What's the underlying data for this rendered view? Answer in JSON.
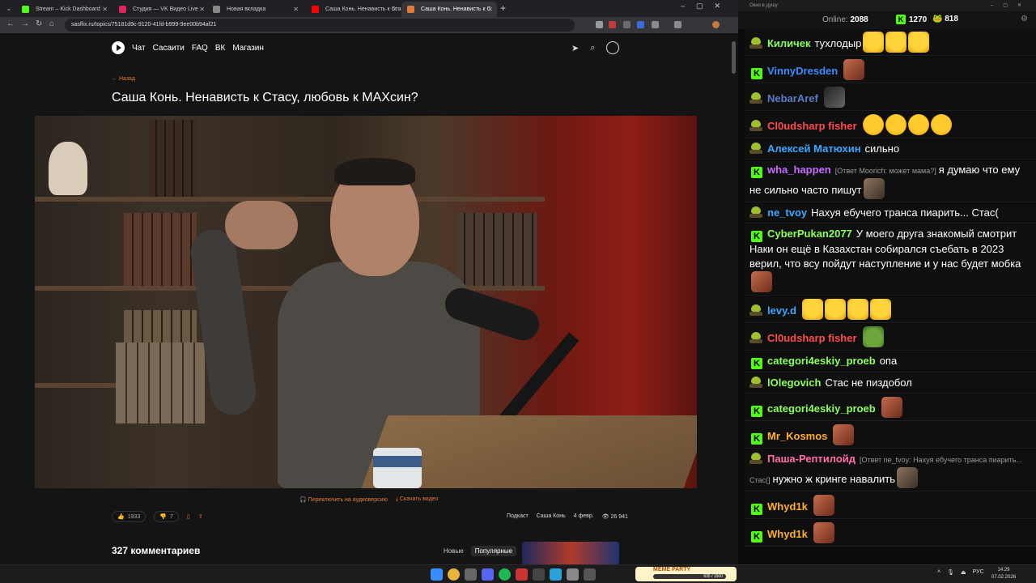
{
  "browser": {
    "tabs": [
      {
        "label": "Stream – Kick Dashboard",
        "color": "#53fc18"
      },
      {
        "label": "Студия — VK Видео Live",
        "color": "#e0245e"
      },
      {
        "label": "Новая вкладка",
        "color": "#888888"
      },
      {
        "label": "Саша Конь. Ненависть к Стасу",
        "color": "#ff0000"
      },
      {
        "label": "Саша Конь. Ненависть к С",
        "color": "#e27b3a"
      }
    ],
    "new_tab": "+",
    "url": "sasflix.ru/topics/75181d9c-9120-41fd-b999-9ee00b94af21"
  },
  "site": {
    "nav": [
      "Чат",
      "Сасаити",
      "FAQ",
      "ВК",
      "Магазин"
    ],
    "back": "← Назад",
    "title": "Саша Конь. Ненависть к Стасу, любовь к МАХсин?",
    "audio_link": "Переключить на аудиоверсию",
    "download_link": "Скачать видео",
    "likes": "1933",
    "dislikes": "7",
    "tag1": "Подкаст",
    "tag2": "Саша Конь",
    "date": "4 февр.",
    "views": "26 941",
    "comments_count": "327 комментариев",
    "sort_new": "Новые",
    "sort_popular": "Популярные"
  },
  "chat": {
    "window_title": "Окно в душу",
    "online_label": "Online:",
    "online_value": "2088",
    "coin1": "1270",
    "coin2": "818",
    "messages": [
      {
        "badge": "pepe",
        "user": "Киличек",
        "color": "#8bff5a",
        "text": "тухлодыр",
        "emotes": [
          "laugh",
          "laugh",
          "laugh"
        ]
      },
      {
        "badge": "kick",
        "user": "VinnyDresden",
        "color": "#3b8cff",
        "text": "",
        "emotes": [
          "face"
        ]
      },
      {
        "badge": "pepe",
        "user": "NebarAref",
        "color": "#5b7dc8",
        "text": "",
        "emotes": [
          "dark"
        ]
      },
      {
        "badge": "pepe",
        "user": "Cl0udsharp fisher",
        "color": "#ff4d4d",
        "text": "",
        "emotes": [
          "cry",
          "cry",
          "cry",
          "cry"
        ]
      },
      {
        "badge": "pepe",
        "user": "Алексей Матюхин",
        "color": "#3ba8ff",
        "text": "сильно",
        "emotes": []
      },
      {
        "badge": "kick",
        "user": "wha_happen",
        "color": "#c86bff",
        "reply": "[Ответ Moorich: может мама?]",
        "text": "я думаю что ему не сильно часто пишут",
        "emotes": [
          "man"
        ]
      },
      {
        "badge": "pepe",
        "user": "ne_tvoy",
        "color": "#3ba8ff",
        "text": "Нахуя ебучего транса пиарить... Стас(",
        "emotes": []
      },
      {
        "badge": "kick",
        "user": "CyberPukan2077",
        "color": "#8bff5a",
        "text": "У моего друга знакомый смотрит Наки он ещё в Казахстан собирался съебать в 2023 верил, что всу пойдут наступление и у нас будет мобка",
        "emotes": [
          "face"
        ]
      },
      {
        "badge": "pepe",
        "user": "levy.d",
        "color": "#3ba8ff",
        "text": "",
        "emotes": [
          "laugh",
          "laugh",
          "laugh",
          "laugh"
        ]
      },
      {
        "badge": "pepe",
        "user": "Cl0udsharp fisher",
        "color": "#ff4d4d",
        "text": "",
        "emotes": [
          "frog"
        ]
      },
      {
        "badge": "kick",
        "user": "categori4eskiy_proeb",
        "color": "#8bff5a",
        "text": "опа",
        "emotes": []
      },
      {
        "badge": "pepe",
        "user": "lOlegovich",
        "color": "#8bff5a",
        "text": "Стас не пиздобол",
        "emotes": []
      },
      {
        "badge": "kick",
        "user": "categori4eskiy_proeb",
        "color": "#8bff5a",
        "text": "",
        "emotes": [
          "face"
        ]
      },
      {
        "badge": "kick",
        "user": "Mr_Kosmos",
        "color": "#ffb02e",
        "text": "",
        "emotes": [
          "face"
        ]
      },
      {
        "badge": "pepe",
        "user": "Паша-Рептилойд",
        "color": "#ff6fa8",
        "reply": "[Ответ ne_tvoy: Нахуя ебучего транса пиарить... Стас(]",
        "text": "нужно ж кринге навалить",
        "emotes": [
          "man"
        ]
      },
      {
        "badge": "kick",
        "user": "Whyd1k",
        "color": "#ffb02e",
        "text": "",
        "emotes": [
          "face"
        ]
      },
      {
        "badge": "kick",
        "user": "Whyd1k",
        "color": "#ffb02e",
        "text": "",
        "emotes": [
          "face"
        ]
      }
    ]
  },
  "taskbar": {
    "meme_title": "MEME PARTY",
    "meme_progress": "635 / 1500",
    "lang": "РУС",
    "time": "14:29",
    "date": "07.02.2026"
  }
}
